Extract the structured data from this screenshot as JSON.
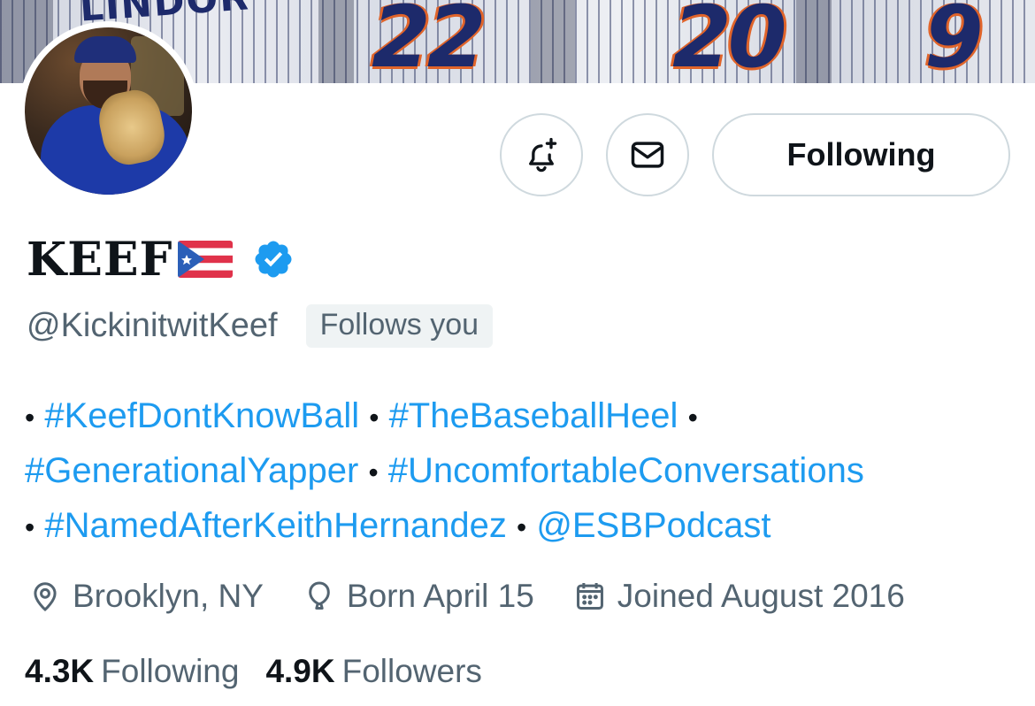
{
  "banner": {
    "jersey_name": "LINDOR",
    "numbers": [
      "22",
      "20",
      "9"
    ]
  },
  "actions": {
    "notify_icon": "bell-plus-icon",
    "message_icon": "envelope-icon",
    "follow_label": "Following"
  },
  "profile": {
    "name": "KEEF",
    "flag_icon": "puerto-rico-flag-icon",
    "verified_icon": "verified-badge-icon",
    "verified_color": "#1d9bf0",
    "handle": "@KickinitwitKeef",
    "follows_you": "Follows you"
  },
  "bio": {
    "bullet": "•",
    "items": [
      "#KeefDontKnowBall",
      "#TheBaseballHeel",
      "#GenerationalYapper",
      "#UncomfortableConversations",
      "#NamedAfterKeithHernandez",
      "@ESBPodcast"
    ],
    "link_color": "#1d9bf0"
  },
  "meta": {
    "location": "Brooklyn, NY",
    "birthday": "Born April 15",
    "joined": "Joined August 2016"
  },
  "stats": {
    "following_count": "4.3K",
    "following_label": "Following",
    "followers_count": "4.9K",
    "followers_label": "Followers"
  }
}
